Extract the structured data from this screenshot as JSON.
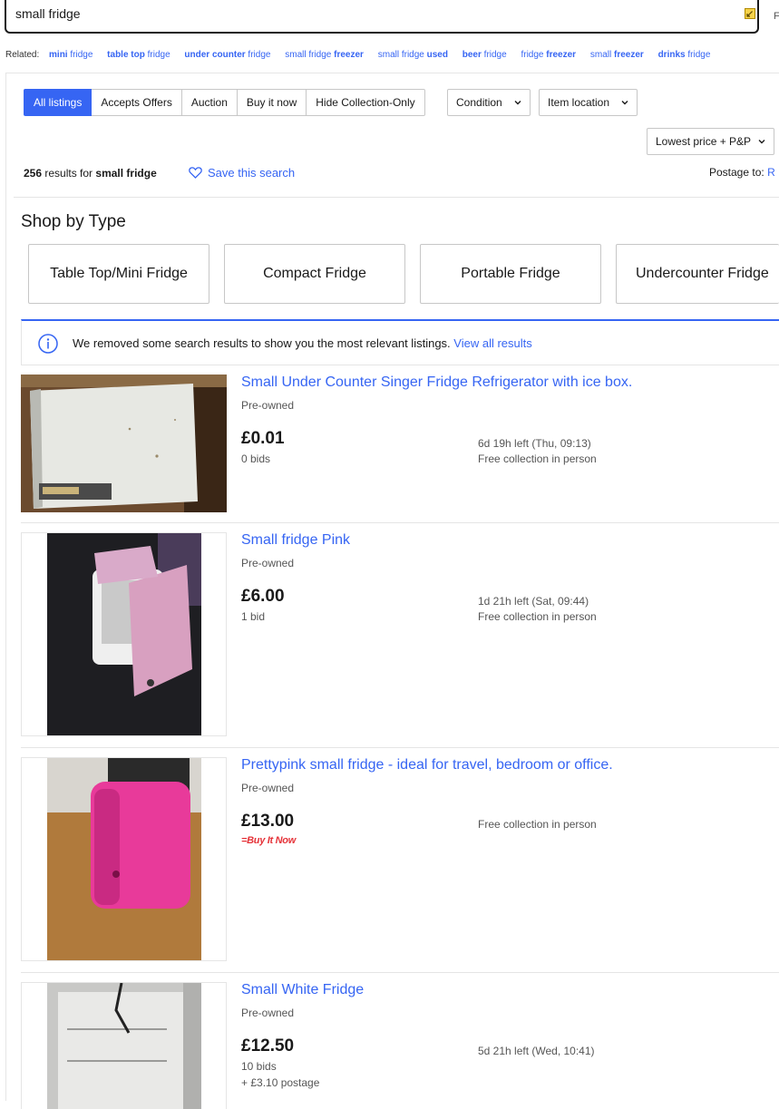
{
  "search": {
    "value": "small fridge",
    "button_edge": "F"
  },
  "related": {
    "label": "Related:",
    "links": [
      {
        "bold": "mini",
        "rest": " fridge"
      },
      {
        "bold": "table top",
        "rest": " fridge"
      },
      {
        "bold": "under counter",
        "rest": " fridge"
      },
      {
        "bold": "",
        "rest": "small fridge ",
        "bold2": "freezer"
      },
      {
        "bold": "",
        "rest": "small fridge ",
        "bold2": "used"
      },
      {
        "bold": "beer",
        "rest": " fridge"
      },
      {
        "bold": "",
        "rest": "fridge ",
        "bold2": "freezer"
      },
      {
        "bold": "",
        "rest": "small ",
        "bold2": "freezer"
      },
      {
        "bold": "drinks",
        "rest": " fridge"
      }
    ]
  },
  "filters": {
    "tabs": [
      "All listings",
      "Accepts Offers",
      "Auction",
      "Buy it now",
      "Hide Collection-Only"
    ],
    "condition": "Condition",
    "location": "Item location",
    "sort": "Lowest price + P&P"
  },
  "results": {
    "count": "256",
    "mid": " results for ",
    "query": "small fridge",
    "save": "Save this search",
    "postage_label": "Postage to:",
    "postage_link": "R"
  },
  "shop_by_type": {
    "title": "Shop by Type",
    "cards": [
      "Table Top/Mini Fridge",
      "Compact Fridge",
      "Portable Fridge",
      "Undercounter Fridge"
    ]
  },
  "notice": {
    "text": "We removed some search results to show you the most relevant listings.",
    "link": "View all results"
  },
  "listings": [
    {
      "title": "Small Under Counter Singer Fridge Refrigerator with ice box.",
      "condition": "Pre-owned",
      "price": "£0.01",
      "bids": "0 bids",
      "time_left": "6d 19h left (Thu, 09:13)",
      "collection": "Free collection in person"
    },
    {
      "title": "Small fridge Pink",
      "condition": "Pre-owned",
      "price": "£6.00",
      "bids": "1 bid",
      "time_left": "1d 21h left (Sat, 09:44)",
      "collection": "Free collection in person"
    },
    {
      "title": "Prettypink small fridge - ideal for travel, bedroom or office.",
      "condition": "Pre-owned",
      "price": "£13.00",
      "buy_it_now": "Buy It Now",
      "collection": "Free collection in person"
    },
    {
      "title": "Small White Fridge",
      "condition": "Pre-owned",
      "price": "£12.50",
      "bids": "10 bids",
      "postage": "+ £3.10 postage",
      "time_left": "5d 21h left (Wed, 10:41)"
    }
  ],
  "colors": {
    "accent": "#3665f3",
    "text": "#191919",
    "muted": "#555555",
    "bin": "#e53238"
  }
}
